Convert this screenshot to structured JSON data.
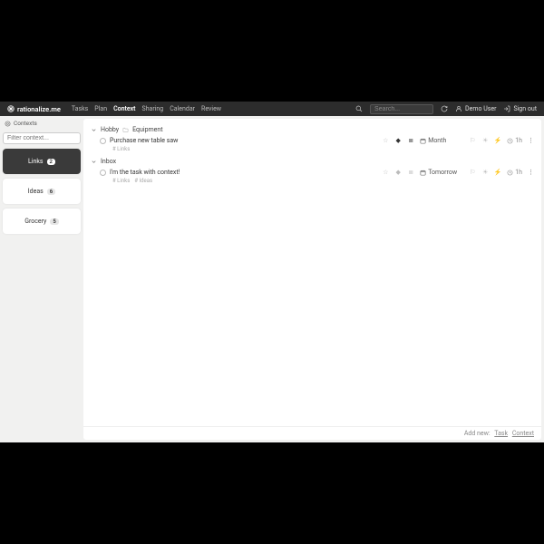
{
  "brand": "rationalize.me",
  "nav": {
    "items": [
      "Tasks",
      "Plan",
      "Context",
      "Sharing",
      "Calendar",
      "Review"
    ],
    "active": "Context"
  },
  "search": {
    "placeholder": "Search..."
  },
  "user": {
    "name": "Demo User",
    "signout": "Sign out"
  },
  "sidebar": {
    "heading": "Contexts",
    "filter_placeholder": "Filter context...",
    "items": [
      {
        "label": "Links",
        "count": "2",
        "active": true
      },
      {
        "label": "Ideas",
        "count": "6",
        "active": false
      },
      {
        "label": "Grocery",
        "count": "5",
        "active": false
      }
    ]
  },
  "groups": [
    {
      "path": [
        "Hobby",
        "Equipment"
      ],
      "tasks": [
        {
          "title": "Purchase new table saw",
          "tags": [
            "# Links"
          ],
          "date": "Month",
          "time": "1h",
          "priority_active": true,
          "list_active": true
        }
      ]
    },
    {
      "path": [
        "Inbox"
      ],
      "tasks": [
        {
          "title": "I'm the task with context!",
          "tags": [
            "# Links",
            "# Ideas"
          ],
          "date": "Tomorrow",
          "time": "1h",
          "priority_active": false,
          "list_active": false
        }
      ]
    }
  ],
  "footer": {
    "label": "Add new:",
    "link_task": "Task",
    "link_context": "Context"
  },
  "icons": {
    "star": "☆",
    "diamond": "◆",
    "list": "≣",
    "flag": "⚐",
    "sun": "☀",
    "bolt": "⚡"
  }
}
